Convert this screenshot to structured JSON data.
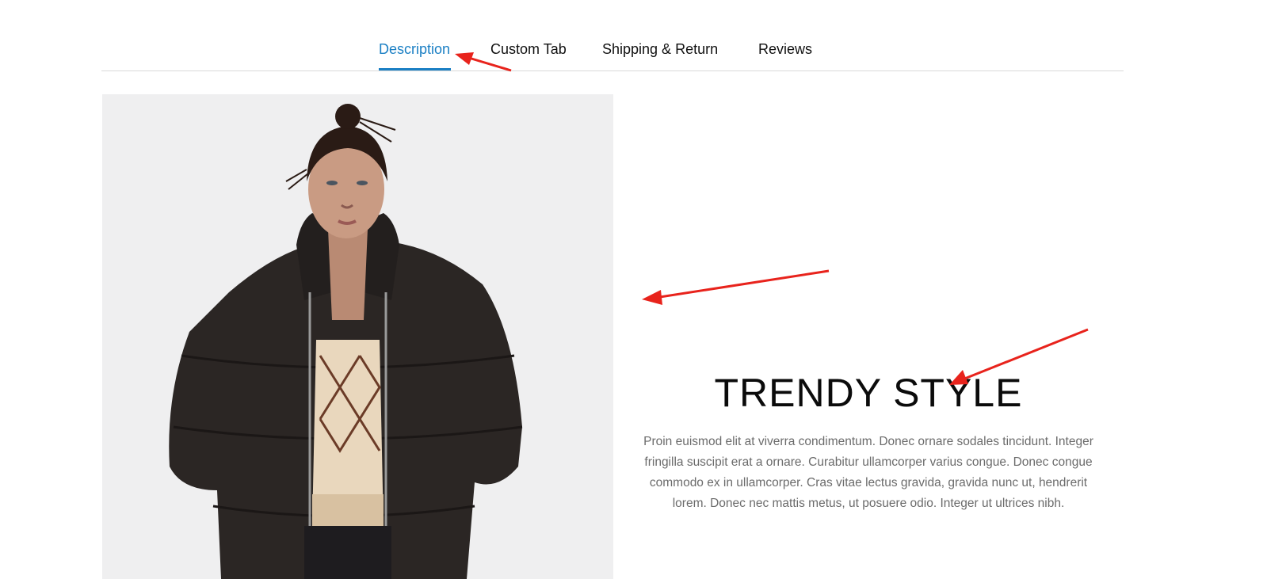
{
  "tabs": [
    {
      "label": "Description",
      "active": true
    },
    {
      "label": "Custom Tab",
      "active": false
    },
    {
      "label": "Shipping & Return",
      "active": false
    },
    {
      "label": "Reviews",
      "active": false
    }
  ],
  "content": {
    "heading": "TRENDY STYLE",
    "body": "Proin euismod elit at viverra condimentum. Donec ornare sodales tincidunt. Integer fringilla suscipit erat a ornare. Curabitur ullamcorper varius congue. Donec congue commodo ex in ullamcorper. Cras vitae lectus gravida, gravida nunc ut, hendrerit lorem. Donec nec mattis metus, ut posuere odio. Integer ut ultrices nibh."
  },
  "colors": {
    "accent": "#1a7fc4",
    "annotation": "#e8231c",
    "heading": "#0b0b0b",
    "body_text": "#6b6b6b",
    "jacket": "#2b2624"
  }
}
